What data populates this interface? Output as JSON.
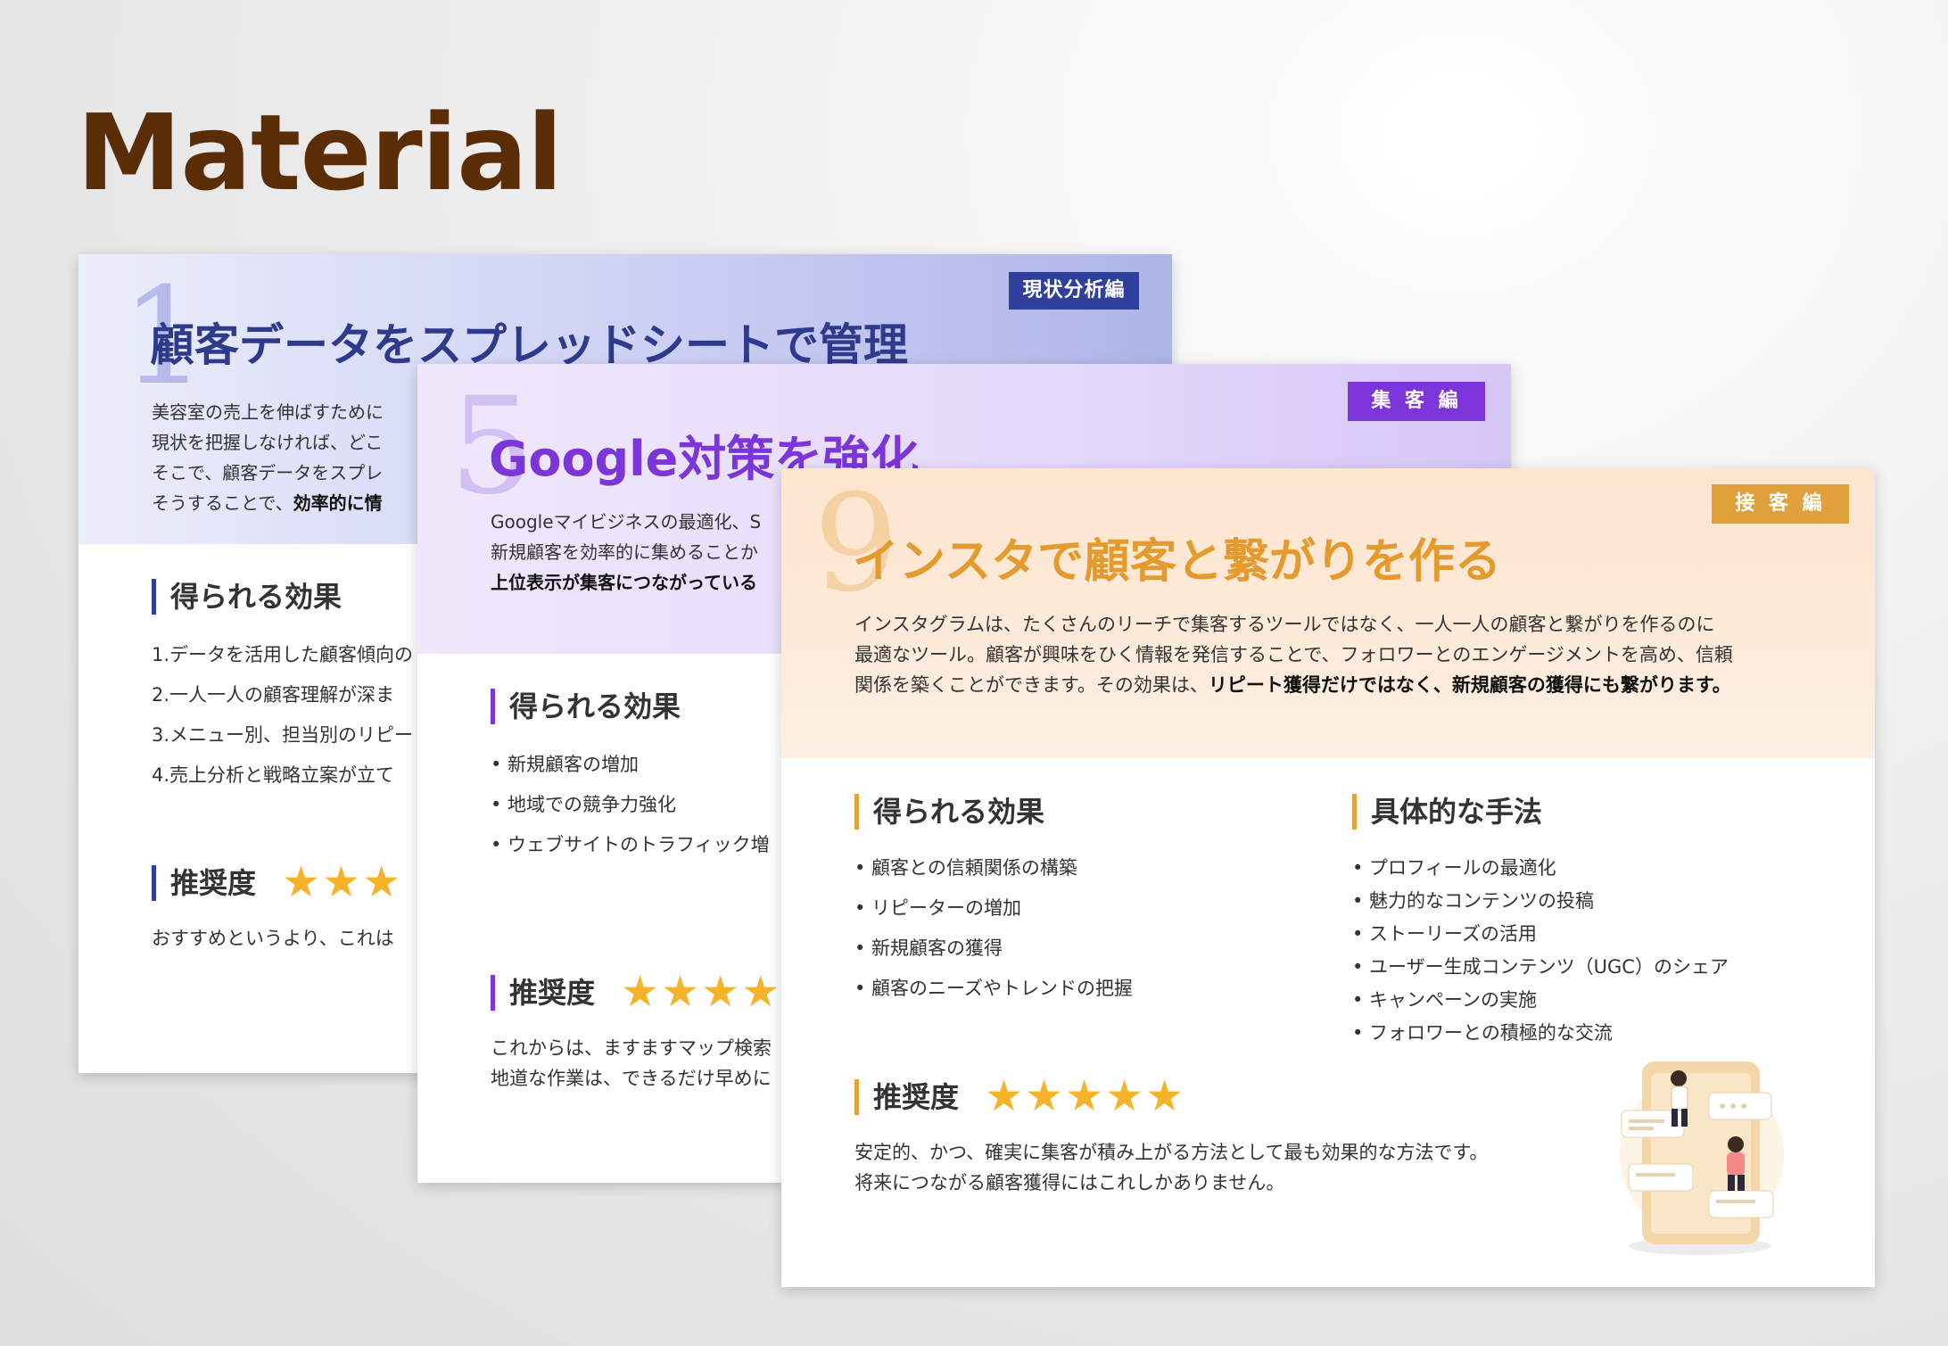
{
  "heading": "Material",
  "card1": {
    "number": "1",
    "title": "顧客データをスプレッドシートで管理",
    "tag": "現状分析編",
    "intro": [
      "美容室の売上を伸ばすために",
      "現状を把握しなければ、どこ",
      "そこで、顧客データをスプレ"
    ],
    "intro_last": "そうすることで、",
    "intro_last_bold": "効率的に情",
    "effects_heading": "得られる効果",
    "effects": [
      "1.データを活用した顧客傾向の",
      "2.一人一人の顧客理解が深ま",
      "3.メニュー別、担当別のリピー",
      "4.売上分析と戦略立案が立て"
    ],
    "rating_heading": "推奨度",
    "rating": 5,
    "stars_text": "★★★",
    "desc": [
      "おすすめというより、これは"
    ]
  },
  "card2": {
    "number": "5",
    "title": "Google対策を強化",
    "tag": "集 客 編",
    "intro": [
      "Googleマイビジネスの最適化、S",
      "新規顧客を効率的に集めることか"
    ],
    "intro_bold": "上位表示が集客につながっている",
    "effects_heading": "得られる効果",
    "effects": [
      "•  新規顧客の増加",
      "•  地域での競争力強化",
      "•  ウェブサイトのトラフィック増"
    ],
    "rating_heading": "推奨度",
    "rating": 5,
    "stars_text": "★★★★",
    "desc": [
      "これからは、ますますマップ検索",
      "地道な作業は、できるだけ早めに"
    ]
  },
  "card3": {
    "number": "9",
    "title": "インスタで顧客と繋がりを作る",
    "tag": "接 客 編",
    "intro": [
      "インスタグラムは、たくさんのリーチで集客するツールではなく、一人一人の顧客と繋がりを作るのに",
      "最適なツール。顧客が興味をひく情報を発信することで、フォロワーとのエンゲージメントを高め、信頼"
    ],
    "intro_last": "関係を築くことができます。その効果は、",
    "intro_last_bold": "リピート獲得だけではなく、新規顧客の獲得にも繋がります。",
    "effects_heading": "得られる効果",
    "effects": [
      "•  顧客との信頼関係の構築",
      "•  リピーターの増加",
      "•  新規顧客の獲得",
      "•  顧客のニーズやトレンドの把握"
    ],
    "methods_heading": "具体的な手法",
    "methods": [
      "•  プロフィールの最適化",
      "•  魅力的なコンテンツの投稿",
      "•  ストーリーズの活用",
      "•  ユーザー生成コンテンツ（UGC）のシェア",
      "•  キャンペーンの実施",
      "•  フォロワーとの積極的な交流"
    ],
    "rating_heading": "推奨度",
    "rating": 5,
    "stars_text": "★★★★★",
    "desc": [
      "安定的、かつ、確実に集客が積み上がる方法として最も効果的な方法です。",
      "将来につながる顧客獲得にはこれしかありません。"
    ]
  }
}
